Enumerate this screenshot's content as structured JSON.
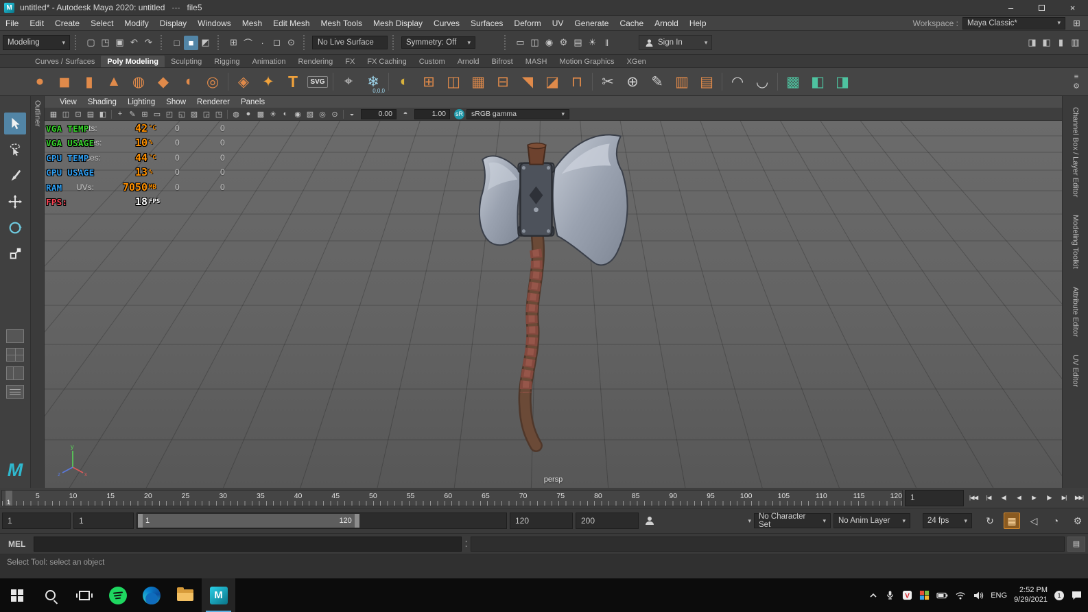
{
  "titlebar": {
    "app_icon": "M",
    "title": "untitled* - Autodesk Maya 2020: untitled",
    "separator": "---",
    "file_label": "file5",
    "minimize": "–",
    "close": "×"
  },
  "menubar": {
    "items": [
      "File",
      "Edit",
      "Create",
      "Select",
      "Modify",
      "Display",
      "Windows",
      "Mesh",
      "Edit Mesh",
      "Mesh Tools",
      "Mesh Display",
      "Curves",
      "Surfaces",
      "Deform",
      "UV",
      "Generate",
      "Cache",
      "Arnold",
      "Help"
    ],
    "workspace_label": "Workspace :",
    "workspace_value": "Maya Classic*",
    "workspace_icon": "⊞"
  },
  "statusline": {
    "mode": "Modeling",
    "file_icons": [
      {
        "name": "new-scene-icon",
        "glyph": "▢"
      },
      {
        "name": "open-scene-icon",
        "glyph": "◳"
      },
      {
        "name": "save-scene-icon",
        "glyph": "▣"
      },
      {
        "name": "undo-icon",
        "glyph": "↶"
      },
      {
        "name": "redo-icon",
        "glyph": "↷"
      }
    ],
    "selection_icons": [
      {
        "name": "select-by-hierarchy-icon",
        "glyph": "□"
      },
      {
        "name": "select-by-object-icon",
        "glyph": "■",
        "active": true
      },
      {
        "name": "select-by-component-icon",
        "glyph": "◩"
      }
    ],
    "snap_icons": [
      {
        "name": "snap-to-grid-icon",
        "glyph": "⊞"
      },
      {
        "name": "snap-to-curve-icon",
        "glyph": "⌒"
      },
      {
        "name": "snap-to-point-icon",
        "glyph": "∙"
      },
      {
        "name": "snap-to-view-plane-icon",
        "glyph": "◻"
      },
      {
        "name": "make-live-icon",
        "glyph": "⊙"
      }
    ],
    "live_surface": "No Live Surface",
    "symmetry": "Symmetry: Off",
    "render_icons": [
      {
        "name": "open-render-view-icon",
        "glyph": "▭"
      },
      {
        "name": "render-current-frame-icon",
        "glyph": "◫"
      },
      {
        "name": "ipr-render-icon",
        "glyph": "◉"
      },
      {
        "name": "render-settings-icon",
        "glyph": "⚙"
      },
      {
        "name": "display-layer-icon",
        "glyph": "▤"
      },
      {
        "name": "light-editor-icon",
        "glyph": "☀"
      },
      {
        "name": "pause-viewport-icon",
        "glyph": "‖"
      }
    ],
    "sign_in": "Sign In",
    "sidebar_toggles": [
      {
        "name": "toggle-attribute-editor-icon",
        "glyph": "◨"
      },
      {
        "name": "toggle-tool-settings-icon",
        "glyph": "◧"
      },
      {
        "name": "toggle-channel-box-icon",
        "glyph": "▮"
      },
      {
        "name": "toggle-outliner-icon",
        "glyph": "▥"
      }
    ]
  },
  "shelf": {
    "tabs": [
      {
        "label": "Curves / Surfaces"
      },
      {
        "label": "Poly Modeling",
        "active": true
      },
      {
        "label": "Sculpting"
      },
      {
        "label": "Rigging"
      },
      {
        "label": "Animation"
      },
      {
        "label": "Rendering"
      },
      {
        "label": "FX"
      },
      {
        "label": "FX Caching"
      },
      {
        "label": "Custom"
      },
      {
        "label": "Arnold"
      },
      {
        "label": "Bifrost"
      },
      {
        "label": "MASH"
      },
      {
        "label": "Motion Graphics"
      },
      {
        "label": "XGen"
      }
    ],
    "icons": [
      {
        "name": "poly-sphere-icon",
        "glyph": "●",
        "color": "#e08a4a"
      },
      {
        "name": "poly-cube-icon",
        "glyph": "◼",
        "color": "#e08a4a"
      },
      {
        "name": "poly-cylinder-icon",
        "glyph": "▮",
        "color": "#e08a4a"
      },
      {
        "name": "poly-cone-icon",
        "glyph": "▲",
        "color": "#e08a4a"
      },
      {
        "name": "poly-torus-icon",
        "glyph": "◍",
        "color": "#e08a4a"
      },
      {
        "name": "poly-pyramid-icon",
        "glyph": "◆",
        "color": "#e08a4a"
      },
      {
        "name": "poly-disc-icon",
        "glyph": "◖",
        "color": "#e08a4a"
      },
      {
        "name": "poly-pipe-icon",
        "glyph": "◎",
        "color": "#e08a4a"
      },
      {
        "cls": "sep"
      },
      {
        "name": "platonic-solid-icon",
        "glyph": "◈",
        "color": "#e08a4a"
      },
      {
        "name": "super-shape-icon",
        "glyph": "✦",
        "color": "#f0a23c"
      },
      {
        "name": "type-tool-icon",
        "glyph": "T",
        "color": "#f0a23c",
        "cls": "boldT"
      },
      {
        "name": "svg-tool-icon",
        "glyph": "SVG",
        "color": "#e6e6e6",
        "cls": "tiny"
      },
      {
        "cls": "sep"
      },
      {
        "name": "construction-plane-icon",
        "glyph": "⌖",
        "color": "#cfcfcf"
      },
      {
        "name": "freeze-to-origin-icon",
        "glyph": "❄",
        "color": "#9fd8ef",
        "sub": "0,0,0"
      },
      {
        "cls": "sep"
      },
      {
        "name": "combine-icon",
        "glyph": "◐",
        "color": "#d9b23c"
      },
      {
        "name": "boolean-union-icon",
        "glyph": "⊞",
        "color": "#e08a4a"
      },
      {
        "name": "separate-icon",
        "glyph": "◫",
        "color": "#e08a4a"
      },
      {
        "name": "smooth-mesh-icon",
        "glyph": "▦",
        "color": "#e08a4a"
      },
      {
        "name": "mirror-icon",
        "glyph": "⊟",
        "color": "#e08a4a"
      },
      {
        "name": "extrude-icon",
        "glyph": "◥",
        "color": "#e08a4a"
      },
      {
        "name": "bevel-icon",
        "glyph": "◪",
        "color": "#e08a4a"
      },
      {
        "name": "bridge-icon",
        "glyph": "⊓",
        "color": "#e08a4a"
      },
      {
        "cls": "sep"
      },
      {
        "name": "multi-cut-icon",
        "glyph": "✂",
        "color": "#cfcfcf"
      },
      {
        "name": "target-weld-icon",
        "glyph": "⊕",
        "color": "#cfcfcf"
      },
      {
        "name": "quad-draw-icon",
        "glyph": "✎",
        "color": "#cfcfcf"
      },
      {
        "name": "insert-edge-loop-icon",
        "glyph": "▥",
        "color": "#e08a4a"
      },
      {
        "name": "offset-edge-loop-icon",
        "glyph": "▤",
        "color": "#e08a4a"
      },
      {
        "cls": "sep"
      },
      {
        "name": "sculpt-tool-icon",
        "glyph": "◠",
        "color": "#cfcfcf"
      },
      {
        "name": "relax-tool-icon",
        "glyph": "◡",
        "color": "#cfcfcf"
      },
      {
        "cls": "sep"
      },
      {
        "name": "uv-planar-projection-icon",
        "glyph": "▩",
        "color": "#4ec3a0"
      },
      {
        "name": "uv-automatic-projection-icon",
        "glyph": "◧",
        "color": "#4ec3a0"
      },
      {
        "name": "uv-editor-icon",
        "glyph": "◨",
        "color": "#4ec3a0"
      }
    ],
    "menu_icons": [
      {
        "name": "shelf-menu-icon",
        "glyph": "≡"
      },
      {
        "name": "shelf-gear-icon",
        "glyph": "⚙"
      }
    ]
  },
  "toolbox": {
    "tools": [
      {
        "name": "select-tool",
        "active": true
      },
      {
        "name": "lasso-tool"
      },
      {
        "name": "paint-selection-tool"
      },
      {
        "name": "move-tool"
      },
      {
        "name": "rotate-tool"
      },
      {
        "name": "scale-tool"
      }
    ]
  },
  "outliner_label": "Outliner",
  "panel": {
    "menus": [
      "View",
      "Shading",
      "Lighting",
      "Show",
      "Renderer",
      "Panels"
    ],
    "icons": [
      {
        "name": "viewport-select-camera-icon",
        "glyph": "▦"
      },
      {
        "name": "viewport-lock-camera-icon",
        "glyph": "◫"
      },
      {
        "name": "viewport-camera-attributes-icon",
        "glyph": "⊡"
      },
      {
        "name": "viewport-bookmarks-icon",
        "glyph": "▤"
      },
      {
        "name": "viewport-image-plane-icon",
        "glyph": "◧"
      },
      {
        "cls": "sep"
      },
      {
        "name": "viewport-2d-pan-zoom-icon",
        "glyph": "+"
      },
      {
        "name": "viewport-grease-pencil-icon",
        "glyph": "✎"
      },
      {
        "name": "viewport-grid-icon",
        "glyph": "⊞"
      },
      {
        "name": "viewport-film-gate-icon",
        "glyph": "▭"
      },
      {
        "name": "viewport-resolution-gate-icon",
        "glyph": "◰"
      },
      {
        "name": "viewport-gate-mask-icon",
        "glyph": "◱"
      },
      {
        "name": "viewport-field-chart-icon",
        "glyph": "▨"
      },
      {
        "name": "viewport-safe-action-icon",
        "glyph": "◲"
      },
      {
        "name": "viewport-safe-title-icon",
        "glyph": "◳"
      },
      {
        "cls": "sep"
      },
      {
        "name": "viewport-wireframe-icon",
        "glyph": "◍"
      },
      {
        "name": "viewport-shaded-icon",
        "glyph": "●"
      },
      {
        "name": "viewport-textured-icon",
        "glyph": "▩"
      },
      {
        "name": "viewport-lights-icon",
        "glyph": "☀"
      },
      {
        "name": "viewport-shadows-icon",
        "glyph": "◐"
      },
      {
        "name": "viewport-ao-icon",
        "glyph": "◉"
      },
      {
        "name": "viewport-antialiasing-icon",
        "glyph": "▧"
      },
      {
        "name": "viewport-xray-icon",
        "glyph": "◎"
      },
      {
        "name": "viewport-isolate-select-icon",
        "glyph": "⊙"
      },
      {
        "cls": "sep"
      },
      {
        "name": "viewport-exposure-icon",
        "glyph": "◒"
      }
    ],
    "exposure": "0.00",
    "gamma_icon": "◓",
    "gamma": "1.00",
    "cm_badge": "sR",
    "view_transform": "sRGB gamma"
  },
  "viewport": {
    "camera_label": "persp",
    "hud": {
      "labels": [
        "Verts:",
        "Edges:",
        "Faces:",
        "Tris:",
        "UVs:"
      ],
      "selected": [
        "0",
        "0",
        "0",
        "0",
        "0"
      ],
      "total": [
        "0",
        "0",
        "0",
        "0",
        "0"
      ]
    },
    "osd": [
      {
        "label": "VGA TEMP",
        "value": "42",
        "unit": "°C",
        "color": "#38d42c",
        "vcolor": "#ff9000"
      },
      {
        "label": "VGA USAGE",
        "value": "10",
        "unit": "%",
        "color": "#38d42c",
        "vcolor": "#ff9000"
      },
      {
        "label": "CPU TEMP",
        "value": "44",
        "unit": "°C",
        "color": "#2f9ff2",
        "vcolor": "#ff9000"
      },
      {
        "label": "CPU USAGE",
        "value": "13",
        "unit": "%",
        "color": "#2f9ff2",
        "vcolor": "#ff9000"
      },
      {
        "label": "RAM",
        "value": "7050",
        "unit": "MB",
        "color": "#2f9ff2",
        "vcolor": "#ff9000"
      },
      {
        "label": "FPS:",
        "value": "18",
        "unit": "FPS",
        "color": "#ff4455",
        "vcolor": "#ffffff"
      }
    ],
    "axis": {
      "x": "x",
      "y": "y",
      "z": "z"
    }
  },
  "sidebar": {
    "tabs": [
      "Channel Box / Layer Editor",
      "Modeling Toolkit",
      "Attribute Editor",
      "UV Editor"
    ]
  },
  "timeslider": {
    "ticks": [
      "5",
      "10",
      "15",
      "20",
      "25",
      "30",
      "35",
      "40",
      "45",
      "50",
      "55",
      "60",
      "65",
      "70",
      "75",
      "80",
      "85",
      "90",
      "95",
      "100",
      "105",
      "110",
      "115",
      "120"
    ],
    "current_frame": "1",
    "current_time_field": "1",
    "transport": [
      {
        "name": "go-to-start-button",
        "glyph": "|◀◀"
      },
      {
        "name": "step-back-frame-button",
        "glyph": "|◀"
      },
      {
        "name": "step-back-key-button",
        "glyph": "◀|"
      },
      {
        "name": "play-backwards-button",
        "glyph": "◀"
      },
      {
        "name": "play-forwards-button",
        "glyph": "▶"
      },
      {
        "name": "step-forward-key-button",
        "glyph": "|▶"
      },
      {
        "name": "step-forward-frame-button",
        "glyph": "▶|"
      },
      {
        "name": "go-to-end-button",
        "glyph": "▶▶|"
      }
    ]
  },
  "rangeslider": {
    "animation_start": "1",
    "playback_start": "1",
    "range_start": "1",
    "range_end": "120",
    "playback_end": "120",
    "animation_end": "200",
    "character_set": "No Character Set",
    "anim_layer": "No Anim Layer",
    "fps": "24 fps",
    "end_icons": [
      {
        "name": "loop-mode-icon",
        "glyph": "↻"
      },
      {
        "name": "cached-playback-icon",
        "glyph": "▦",
        "cls": "hl"
      },
      {
        "name": "mute-playback-icon",
        "glyph": "◁"
      },
      {
        "name": "playback-speed-icon",
        "glyph": "◔"
      },
      {
        "name": "animation-preferences-icon",
        "glyph": "⚙"
      }
    ]
  },
  "command_line": {
    "label": "MEL",
    "separator": ":"
  },
  "help_line": {
    "text": "Select Tool: select an object"
  },
  "taskbar": {
    "language": "ENG",
    "time": "2:52 PM",
    "date": "9/29/2021",
    "notification_count": "1"
  }
}
